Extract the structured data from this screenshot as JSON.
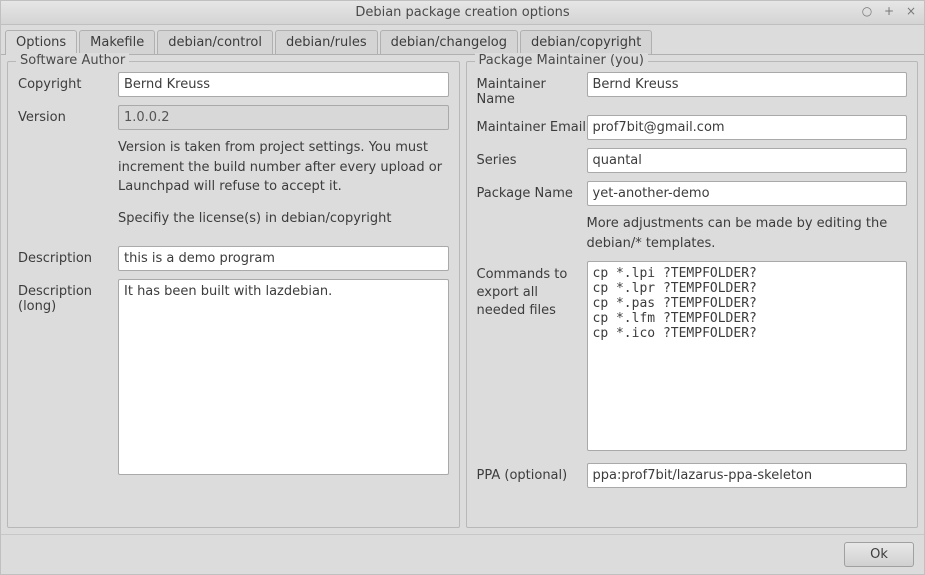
{
  "window": {
    "title": "Debian package creation options"
  },
  "tabs": [
    {
      "label": "Options"
    },
    {
      "label": "Makefile"
    },
    {
      "label": "debian/control"
    },
    {
      "label": "debian/rules"
    },
    {
      "label": "debian/changelog"
    },
    {
      "label": "debian/copyright"
    }
  ],
  "author": {
    "group_title": "Software Author",
    "copyright_label": "Copyright",
    "copyright_value": "Bernd Kreuss",
    "version_label": "Version",
    "version_value": "1.0.0.2",
    "version_help": "Version is taken from project settings. You must increment the build number after every upload or Launchpad will refuse to accept it.",
    "license_help": "Specifiy the license(s) in debian/copyright",
    "desc_label": "Description",
    "desc_value": "this is a demo program",
    "desc_long_label": "Description (long)",
    "desc_long_value": "It has been built with lazdebian."
  },
  "maintainer": {
    "group_title": "Package Maintainer (you)",
    "name_label": "Maintainer Name",
    "name_value": "Bernd Kreuss",
    "email_label": "Maintainer Email",
    "email_value": "prof7bit@gmail.com",
    "series_label": "Series",
    "series_value": "quantal",
    "pkg_label": "Package Name",
    "pkg_value": "yet-another-demo",
    "pkg_help": "More adjustments can be made by editing the debian/* templates.",
    "cmds_label": "Commands to export all needed files",
    "cmds_value": "cp *.lpi ?TEMPFOLDER?\ncp *.lpr ?TEMPFOLDER?\ncp *.pas ?TEMPFOLDER?\ncp *.lfm ?TEMPFOLDER?\ncp *.ico ?TEMPFOLDER?",
    "ppa_label": "PPA (optional)",
    "ppa_value": "ppa:prof7bit/lazarus-ppa-skeleton"
  },
  "buttons": {
    "ok": "Ok"
  }
}
